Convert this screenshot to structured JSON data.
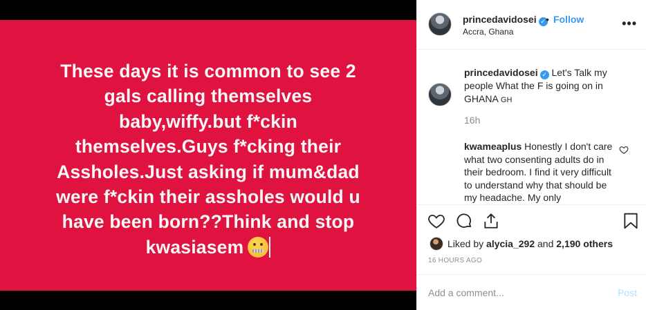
{
  "media": {
    "background_color": "#e0123f",
    "text_lines": [
      "These days it is common to see 2",
      "gals calling themselves",
      "baby,wiffy.but f*ckin",
      "themselves.Guys f*cking their",
      "Assholes.Just asking if mum&dad",
      "were f*ckin their assholes would u",
      "have been born??Think and stop",
      "kwasiasem"
    ],
    "emoji": "zipper-mouth-face"
  },
  "header": {
    "username": "princedavidosei",
    "verified": true,
    "separator": "•",
    "follow_label": "Follow",
    "location": "Accra, Ghana",
    "more_label": "•••"
  },
  "caption": {
    "username": "princedavidosei",
    "text": "Let's Talk my people What the F is going on in GHANA",
    "flag": "GH",
    "age": "16h"
  },
  "comments": [
    {
      "username": "kwameaplus",
      "text": "Honestly I don't care what two consenting adults do in their bedroom. I find it very difficult to understand why that should be my headache. My only"
    }
  ],
  "likes": {
    "prefix": "Liked by",
    "user": "alycia_292",
    "joiner": "and",
    "others": "2,190 others"
  },
  "timestamp": "16 HOURS AGO",
  "add_comment": {
    "placeholder": "Add a comment...",
    "post_label": "Post"
  },
  "colors": {
    "accent": "#3897f0",
    "post_disabled": "#b2dffc",
    "media_red": "#e0123f"
  }
}
